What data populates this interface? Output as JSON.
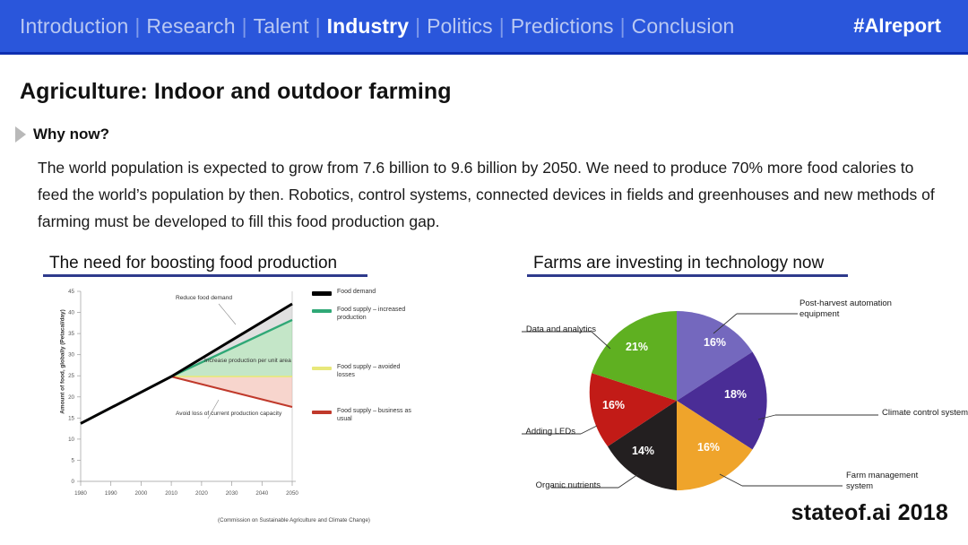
{
  "nav": {
    "items": [
      {
        "label": "Introduction",
        "active": false
      },
      {
        "label": "Research",
        "active": false
      },
      {
        "label": "Talent",
        "active": false
      },
      {
        "label": "Industry",
        "active": true
      },
      {
        "label": "Politics",
        "active": false
      },
      {
        "label": "Predictions",
        "active": false
      },
      {
        "label": "Conclusion",
        "active": false
      }
    ],
    "separator": "|",
    "hashtag": "#AIreport",
    "background_color": "#2a56db",
    "active_color": "#ffffff",
    "inactive_color": "#b9c8f2"
  },
  "slide": {
    "title": "Agriculture: Indoor and outdoor farming",
    "bullet_icon": "triangle-right-icon",
    "why_label": "Why now?",
    "body": "The world population is expected to grow from 7.6 billion to 9.6 billion by 2050. We need to produce 70% more food calories to feed the world’s population by then. Robotics, control systems, connected devices in fields and greenhouses and new methods of farming must be developed to fill this food production gap.",
    "footer": "stateof.ai 2018"
  },
  "sections": {
    "left_heading": "The need for boosting food production",
    "right_heading": "Farms are investing in technology now",
    "rule_color": "#2e3a8c"
  },
  "chart_data": [
    {
      "type": "line",
      "title": "The need for boosting food production",
      "xlabel": "",
      "ylabel": "Amount of food, globally (Petacal/day)",
      "caption": "(Commission on Sustainable Agriculture and Climate Change)",
      "xlim": [
        1980,
        2050
      ],
      "ylim": [
        0,
        45
      ],
      "xticks": [
        "1980",
        "1990",
        "2000",
        "2010",
        "2020",
        "2030",
        "2040",
        "2050"
      ],
      "yticks": [
        "0",
        "5",
        "10",
        "15",
        "20",
        "25",
        "30",
        "35",
        "40",
        "45"
      ],
      "grid": false,
      "legend_position": "right",
      "annotations": [
        "Reduce food demand",
        "Increase production per unit area",
        "Avoid loss of current production capacity"
      ],
      "series": [
        {
          "name": "Food demand",
          "color": "#000000",
          "x": [
            1980,
            2010,
            2050
          ],
          "values": [
            13.7,
            24.8,
            42.0
          ]
        },
        {
          "name": "Food supply – increased production",
          "color": "#2fa876",
          "x": [
            1980,
            2010,
            2050
          ],
          "values": [
            13.7,
            24.8,
            38.2
          ]
        },
        {
          "name": "Food supply – avoided losses",
          "color": "#e8e87a",
          "x": [
            1980,
            2010,
            2050
          ],
          "values": [
            13.7,
            24.8,
            24.8
          ]
        },
        {
          "name": "Food supply – business as usual",
          "color": "#c0392b",
          "x": [
            1980,
            2010,
            2050
          ],
          "values": [
            13.7,
            24.8,
            17.6
          ]
        }
      ]
    },
    {
      "type": "pie",
      "title": "Farms are investing in technology now",
      "legend_position": "callout-labels",
      "labels": [
        "Post-harvest automation equipment",
        "Climate control system",
        "Farm management system",
        "Organic nutrients",
        "Adding LEDs",
        "Data and analytics"
      ],
      "values": [
        16,
        18,
        16,
        14,
        16,
        21
      ],
      "value_labels": [
        "16%",
        "18%",
        "16%",
        "14%",
        "16%",
        "21%"
      ],
      "colors": [
        "#7468be",
        "#4a2d96",
        "#efa42b",
        "#231f20",
        "#c21b17",
        "#5fb021"
      ]
    }
  ]
}
